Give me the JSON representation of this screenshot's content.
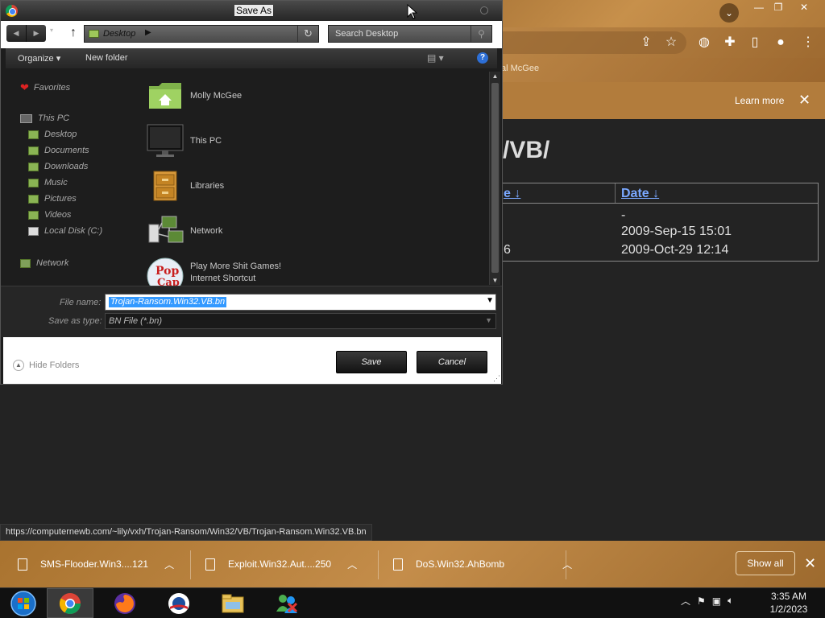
{
  "browser": {
    "bookmark_text": "al McGee",
    "infobar": {
      "learn_more": "Learn more",
      "close": "✕"
    },
    "page_heading": "/VB/",
    "listing": {
      "name_header": "e ↓",
      "date_header": "Date ↓",
      "rows": [
        {
          "name": "",
          "date": "-"
        },
        {
          "name": "",
          "date": "2009-Sep-15 15:01"
        },
        {
          "name": "6",
          "date": "2009-Oct-29 12:14"
        }
      ]
    },
    "status_url": "https://computernewb.com/~lily/vxh/Trojan-Ransom/Win32/VB/Trojan-Ransom.Win32.VB.bn",
    "downloads": [
      {
        "name": "SMS-Flooder.Win3....121"
      },
      {
        "name": "Exploit.Win32.Aut....250"
      },
      {
        "name": "DoS.Win32.AhBomb"
      }
    ],
    "show_all": "Show all",
    "shelf_close": "✕"
  },
  "dialog": {
    "title": "Save As",
    "address": "Desktop",
    "search_placeholder": "Search Desktop",
    "organize": "Organize ▾",
    "new_folder": "New folder",
    "help": "?",
    "nav": {
      "favorites": "Favorites",
      "this_pc": "This PC",
      "desktop": "Desktop",
      "documents": "Documents",
      "downloads": "Downloads",
      "music": "Music",
      "pictures": "Pictures",
      "videos": "Videos",
      "local_disk": "Local Disk (C:)",
      "network": "Network"
    },
    "files": [
      {
        "name": "Molly McGee",
        "icon": "user-folder-icon"
      },
      {
        "name": "This PC",
        "icon": "monitor-icon"
      },
      {
        "name": "Libraries",
        "icon": "cabinet-icon"
      },
      {
        "name": "Network",
        "icon": "network-icon"
      },
      {
        "name": "Play More Shit Games!",
        "sub": "Internet Shortcut",
        "icon": "popcap-icon"
      }
    ],
    "file_name_label": "File name:",
    "file_name_value": "Trojan-Ransom.Win32.VB.bn",
    "save_type_label": "Save as type:",
    "save_type_value": "BN File (*.bn)",
    "hide_folders": "Hide Folders",
    "save": "Save",
    "cancel": "Cancel"
  },
  "taskbar": {
    "time": "3:35 AM",
    "date": "1/2/2023"
  },
  "colors": {
    "chrome_theme": "#b27c3c",
    "link": "#7aa8ff",
    "selection": "#3399ff"
  }
}
